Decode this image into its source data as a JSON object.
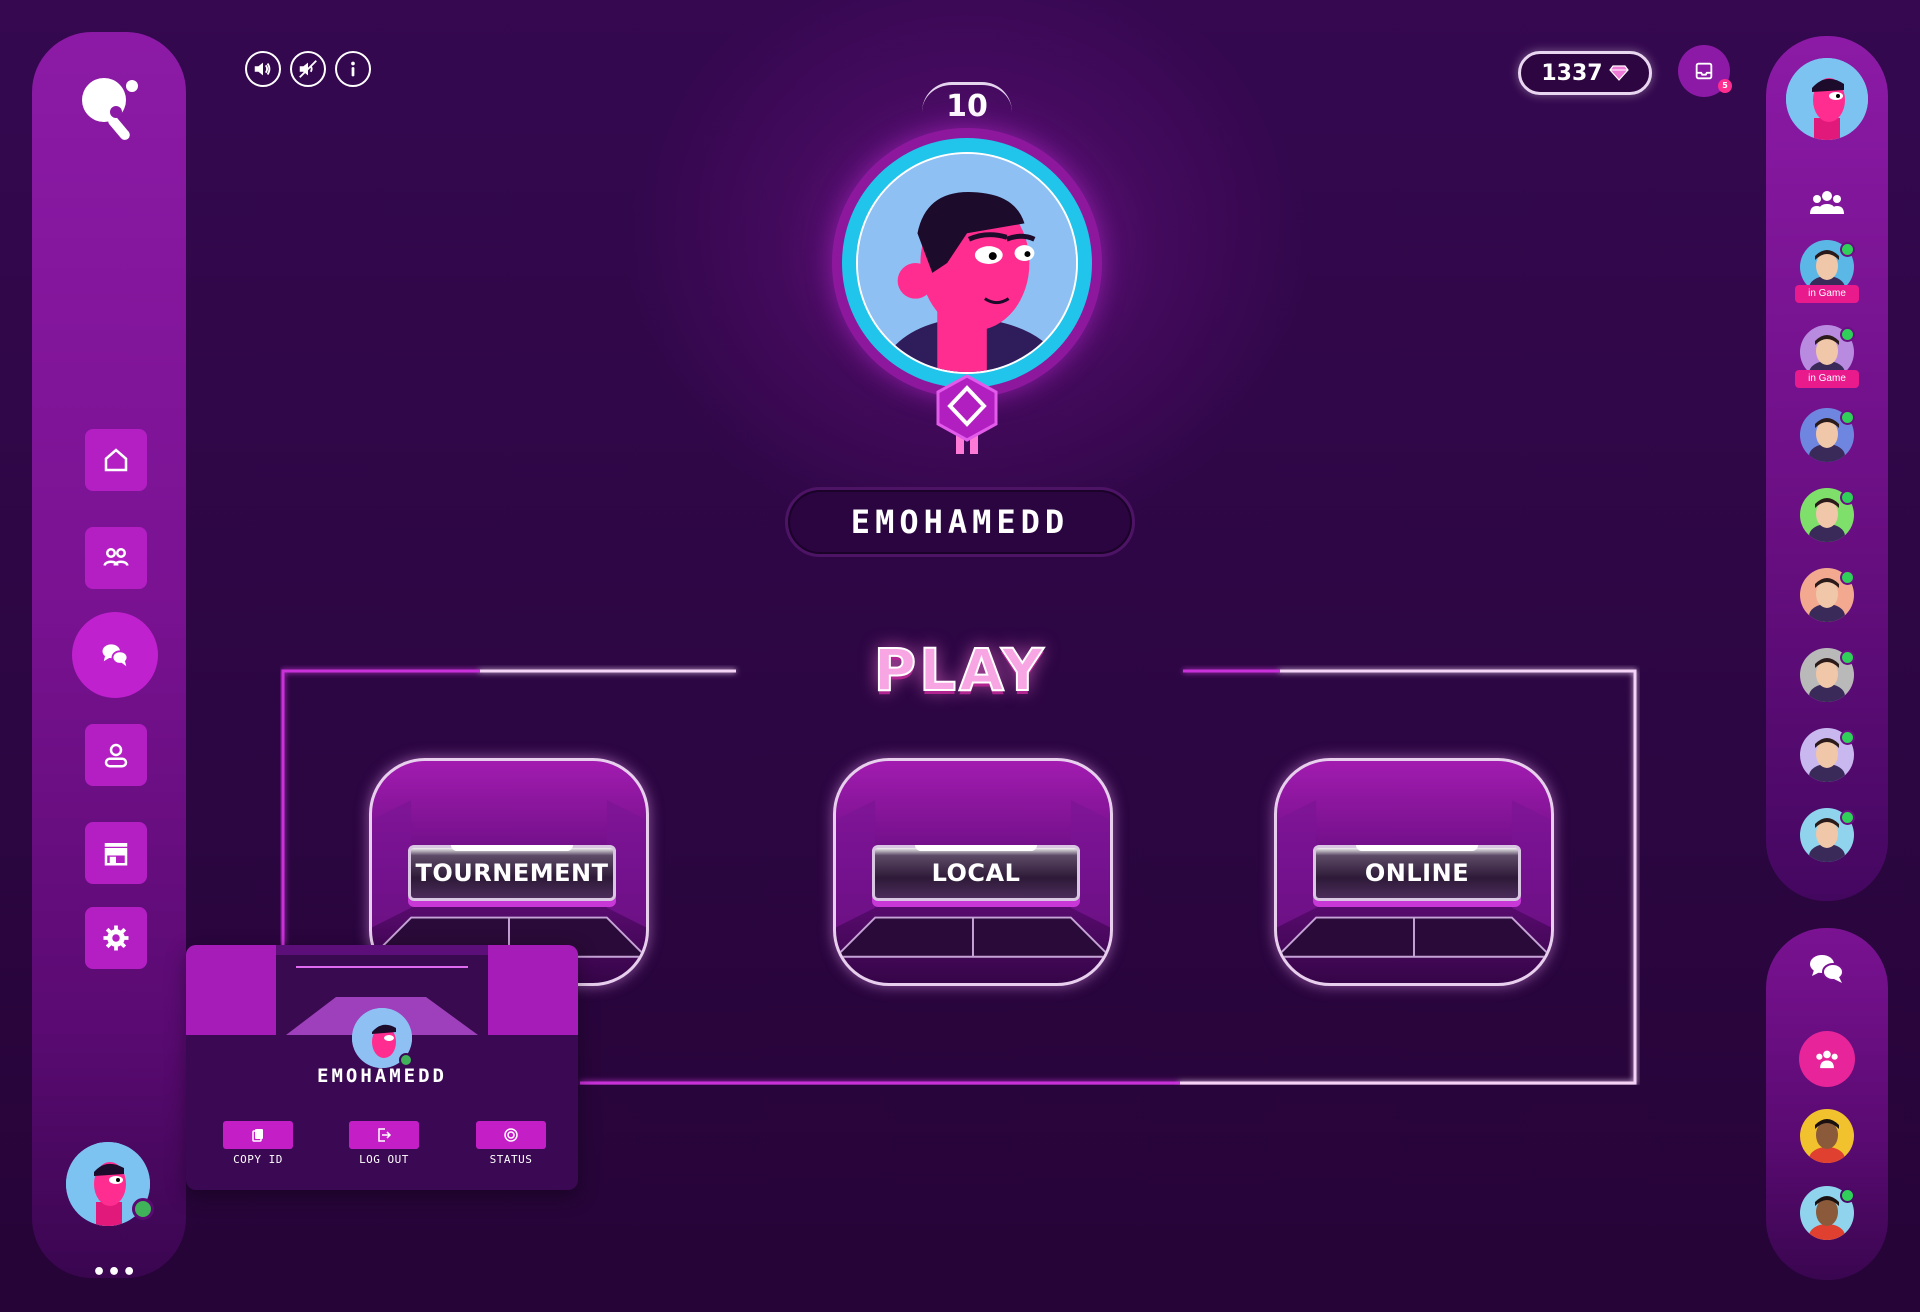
{
  "top_controls": {
    "sound_icon": "speaker-on-icon",
    "mute_icon": "speaker-muted-icon",
    "info_icon": "info-icon"
  },
  "wallet": {
    "gems": "1337",
    "gem_icon": "diamond-icon"
  },
  "inbox": {
    "badge": "5"
  },
  "profile": {
    "level": "10",
    "username": "EMOHAMEDD"
  },
  "play": {
    "title": "PLAY",
    "modes": [
      {
        "label": "TOURNEMENT"
      },
      {
        "label": "LOCAL"
      },
      {
        "label": "ONLINE"
      }
    ]
  },
  "sidebar": {
    "items": [
      {
        "icon": "home-icon"
      },
      {
        "icon": "users-icon"
      },
      {
        "icon": "chat-icon"
      },
      {
        "icon": "profile-icon"
      },
      {
        "icon": "store-icon"
      },
      {
        "icon": "settings-icon"
      }
    ],
    "more": "•••"
  },
  "profile_card": {
    "username": "EMOHAMEDD",
    "actions": [
      {
        "label": "COPY ID",
        "icon": "copy-icon"
      },
      {
        "label": "LOG OUT",
        "icon": "logout-icon"
      },
      {
        "label": "STATUS",
        "icon": "status-icon"
      }
    ]
  },
  "friends": {
    "list": [
      {
        "status": "in Game",
        "color": "#5ab7e6"
      },
      {
        "status": "in Game",
        "color": "#b98be0"
      },
      {
        "status": "",
        "color": "#6f86e0"
      },
      {
        "status": "",
        "color": "#7ee06a"
      },
      {
        "status": "",
        "color": "#f2a98f"
      },
      {
        "status": "",
        "color": "#b9b9b9"
      },
      {
        "status": "",
        "color": "#c9b8f0"
      },
      {
        "status": "",
        "color": "#8fd4ec"
      }
    ],
    "chat_list": [
      {
        "color": "#f2c22e"
      },
      {
        "color": "#8fd4ec"
      }
    ]
  },
  "colors": {
    "accent": "#c021cf",
    "background": "#2a063d",
    "online": "#3fb25a",
    "in_game_badge": "#e81a8c",
    "play_title": "#f7a6e3"
  }
}
